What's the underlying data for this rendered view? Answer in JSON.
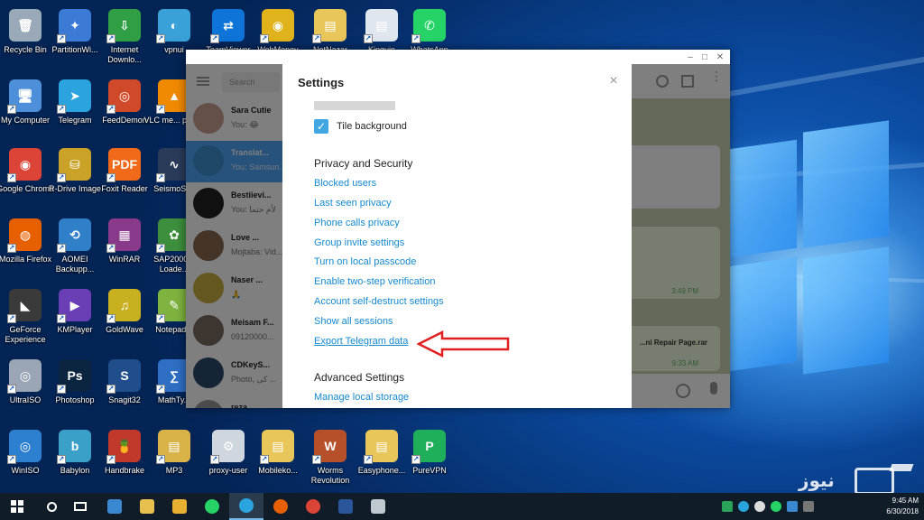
{
  "desktop": {
    "icons": [
      {
        "label": "Recycle Bin",
        "color": "#9aa9b8",
        "glyph": "🗑"
      },
      {
        "label": "PartitionWi...",
        "color": "#3b7bd6",
        "glyph": "✦"
      },
      {
        "label": "Internet Downlo...",
        "color": "#2f9e44",
        "glyph": "⇩"
      },
      {
        "label": "vpnui",
        "color": "#3aa0d8",
        "glyph": "◐"
      },
      {
        "label": "TeamViewer",
        "color": "#0e74d8",
        "glyph": "⇄"
      },
      {
        "label": "WebMoney",
        "color": "#e0b21b",
        "glyph": "◉"
      },
      {
        "label": "NetNazar",
        "color": "#e8c65a",
        "glyph": "▤"
      },
      {
        "label": "Kinguin",
        "color": "#dfe6ee",
        "glyph": "▤"
      },
      {
        "label": "WhatsApp",
        "color": "#25d366",
        "glyph": "✆"
      },
      {
        "label": "My Computer",
        "color": "#4d8fd9",
        "glyph": "🖥"
      },
      {
        "label": "Telegram",
        "color": "#2aa3df",
        "glyph": "➤"
      },
      {
        "label": "FeedDemon",
        "color": "#d04a2a",
        "glyph": "◎"
      },
      {
        "label": "VLC me... player",
        "color": "#f08a00",
        "glyph": "▲"
      },
      {
        "label": "Google Chrome",
        "color": "#db4437",
        "glyph": "◉"
      },
      {
        "label": "R-Drive Image",
        "color": "#c9a227",
        "glyph": "⛁"
      },
      {
        "label": "Foxit Reader",
        "color": "#f06a1a",
        "glyph": "PDF"
      },
      {
        "label": "SeismoSi...",
        "color": "#2a3b5a",
        "glyph": "∿"
      },
      {
        "label": "Mozilla Firefox",
        "color": "#e66000",
        "glyph": "◍"
      },
      {
        "label": "AOMEI Backupp...",
        "color": "#2f80c8",
        "glyph": "⟲"
      },
      {
        "label": "WinRAR",
        "color": "#8a3a8a",
        "glyph": "▦"
      },
      {
        "label": "SAP2000... Loade...",
        "color": "#3d8f3d",
        "glyph": "✿"
      },
      {
        "label": "GeForce Experience",
        "color": "#3a3a3a",
        "glyph": "◣"
      },
      {
        "label": "KMPlayer",
        "color": "#6a3fb5",
        "glyph": "▶"
      },
      {
        "label": "GoldWave",
        "color": "#c8b020",
        "glyph": "♫"
      },
      {
        "label": "Notepad...",
        "color": "#7fb33f",
        "glyph": "✎"
      },
      {
        "label": "UltraISO",
        "color": "#9aa5b5",
        "glyph": "◎"
      },
      {
        "label": "Photoshop",
        "color": "#0b2540",
        "glyph": "Ps"
      },
      {
        "label": "Snagit32",
        "color": "#1f4e8a",
        "glyph": "S"
      },
      {
        "label": "MathTy...",
        "color": "#2e6fc4",
        "glyph": "∑"
      },
      {
        "label": "WinISO",
        "color": "#2d7fd0",
        "glyph": "◎"
      },
      {
        "label": "Babylon",
        "color": "#3aa0c8",
        "glyph": "b"
      },
      {
        "label": "Handbrake",
        "color": "#c0392b",
        "glyph": "🍍"
      },
      {
        "label": "MP3",
        "color": "#d9b347",
        "glyph": "▤"
      },
      {
        "label": "proxy-user",
        "color": "#cfd6de",
        "glyph": "⚙"
      },
      {
        "label": "Mobileko...",
        "color": "#e8c65a",
        "glyph": "▤"
      },
      {
        "label": "Worms Revolution",
        "color": "#b5502a",
        "glyph": "W"
      },
      {
        "label": "Easyphone...",
        "color": "#e8c65a",
        "glyph": "▤"
      },
      {
        "label": "PureVPN",
        "color": "#1fae5a",
        "glyph": "P"
      }
    ]
  },
  "telegram": {
    "search_placeholder": "Search",
    "chats": [
      {
        "title": "Sara Cutie",
        "sub": "You: 😂",
        "avatar": "#c8a090"
      },
      {
        "title": "Translat...",
        "sub": "You: Samsun...",
        "avatar": "#3d8fd0"
      },
      {
        "title": "Bestiievi...",
        "sub": "You: لأم حتما",
        "avatar": "#222222"
      },
      {
        "title": "Love ...",
        "sub": "Mojtaba: Vid...",
        "avatar": "#8a6a50"
      },
      {
        "title": "Naser ...",
        "sub": "🙏",
        "avatar": "#c9b040"
      },
      {
        "title": "Meisam F...",
        "sub": "09120000...",
        "avatar": "#7a6a60"
      },
      {
        "title": "CDKeyS...",
        "sub": "Photo, کی ...",
        "avatar": "#2a4a6a"
      },
      {
        "title": "reza",
        "sub": "",
        "avatar": "#999999"
      }
    ],
    "messages": [
      {
        "text": "3:49 PM"
      },
      {
        "text": "...ni Repair Page.rar"
      },
      {
        "text": "9:33 AM"
      }
    ]
  },
  "settings": {
    "title": "Settings",
    "close_glyph": "×",
    "tile_background_label": "Tile background",
    "privacy_heading": "Privacy and Security",
    "privacy_links": [
      "Blocked users",
      "Last seen privacy",
      "Phone calls privacy",
      "Group invite settings",
      "Turn on local passcode",
      "Enable two-step verification",
      "Account self-destruct settings",
      "Show all sessions",
      "Export Telegram data"
    ],
    "advanced_heading": "Advanced Settings",
    "advanced_links": [
      "Manage local storage"
    ],
    "link_color": "#168acd",
    "check_color": "#40a7e3",
    "annotation_arrow_color": "#e02020"
  },
  "taskbar": {
    "time": "9:45 AM",
    "date": "6/30/2018"
  },
  "watermark": {
    "text": "نیوز"
  }
}
